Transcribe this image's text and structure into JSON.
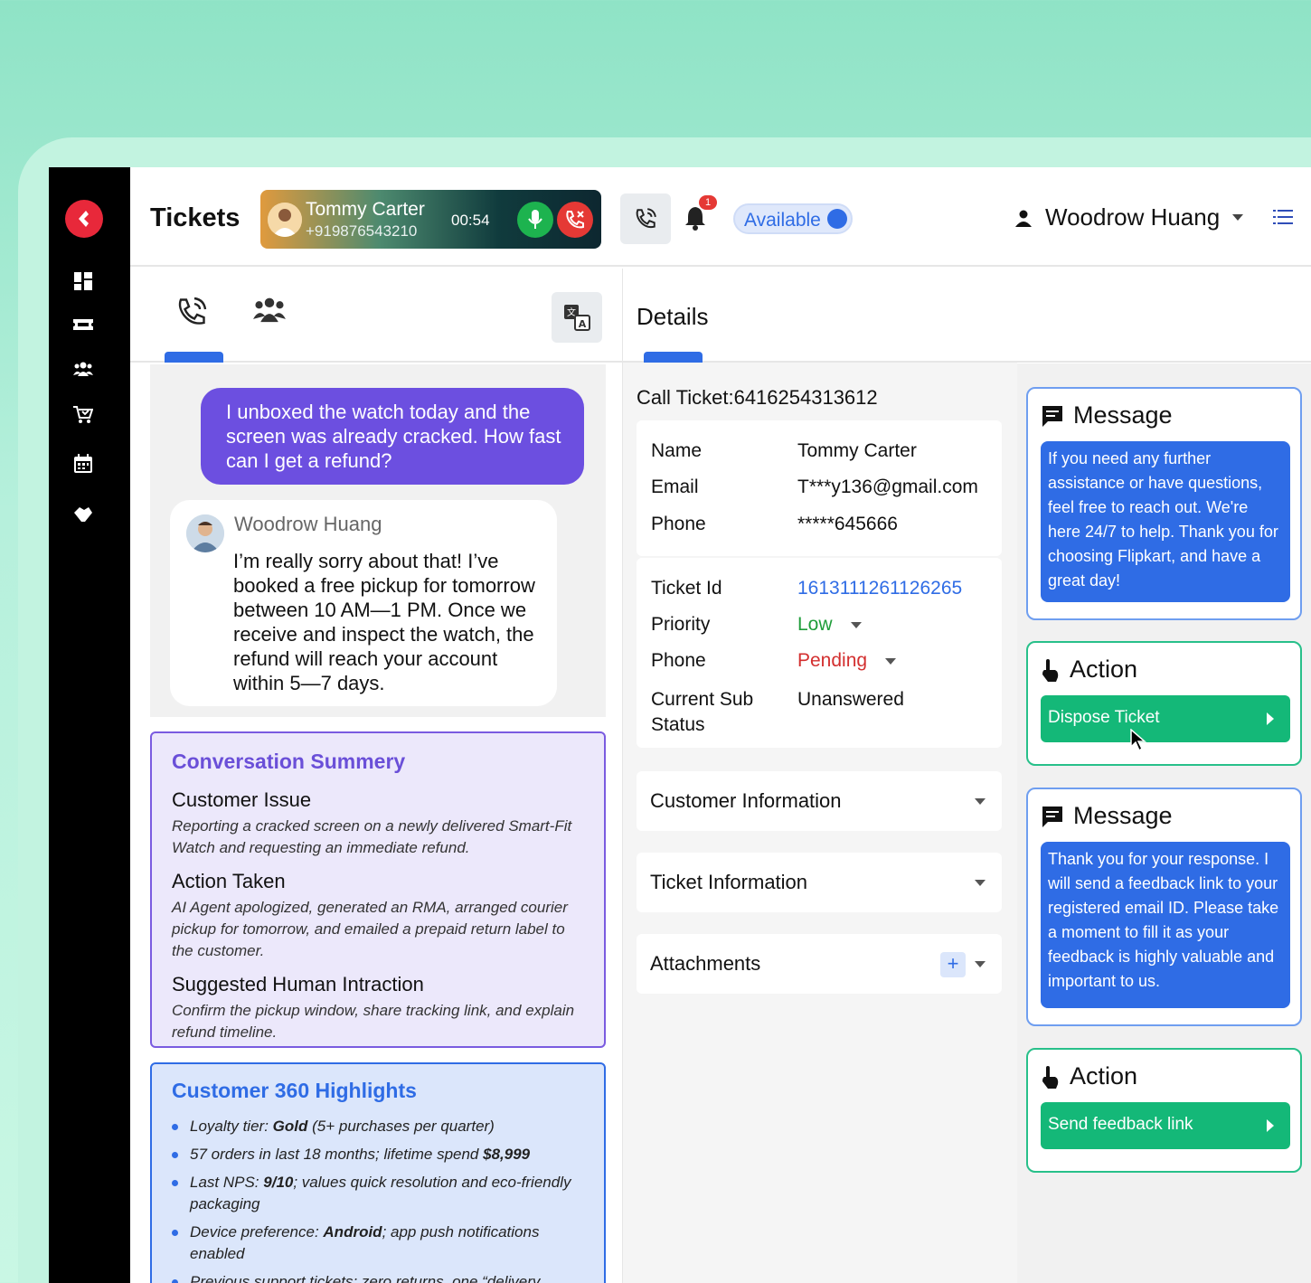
{
  "header": {
    "title": "Tickets",
    "caller": {
      "name": "Tommy Carter",
      "number": "+919876543210",
      "timer": "00:54"
    },
    "notification_count": "1",
    "status": "Available",
    "user_name": "Woodrow Huang"
  },
  "conversation": {
    "customer_message": "I unboxed the watch today and the screen was already cracked. How fast can I get a refund?",
    "agent_name": "Woodrow Huang",
    "agent_message": "I’m really sorry about that! I’ve booked a free pickup for tomorrow between 10 AM—1 PM. Once we receive and inspect the watch, the refund will reach your account within 5—7 days."
  },
  "summary": {
    "title": "Conversation Summery",
    "sections": [
      {
        "heading": "Customer Issue",
        "text": "Reporting a cracked screen on a newly delivered Smart-Fit Watch and requesting an immediate refund."
      },
      {
        "heading": "Action Taken",
        "text": "AI Agent apologized, generated an RMA, arranged courier pickup for tomorrow, and emailed a prepaid return label to the customer."
      },
      {
        "heading": "Suggested Human Intraction",
        "text": "Confirm the pickup window, share tracking link, and explain refund timeline."
      }
    ]
  },
  "highlights": {
    "title": "Customer 360 Highlights",
    "items": [
      {
        "pre": "Loyalty tier: ",
        "bold": "Gold",
        "post": " (5+ purchases per quarter)"
      },
      {
        "pre": "57 orders in last 18 months; lifetime spend ",
        "bold": "$8,999",
        "post": ""
      },
      {
        "pre": "Last NPS: ",
        "bold": "9/10",
        "post": "; values quick resolution and eco-friendly packaging"
      },
      {
        "pre": "Device preference: ",
        "bold": "Android",
        "post": "; app push notifications enabled"
      },
      {
        "pre": "Previous support tickets: zero returns, one “delivery delay” chat (resolved)",
        "bold": "",
        "post": ""
      }
    ]
  },
  "details": {
    "title": "Details",
    "call_ticket": "Call Ticket:6416254313612",
    "contact": {
      "name_label": "Name",
      "name": "Tommy Carter",
      "email_label": "Email",
      "email": "T***y136@gmail.com",
      "phone_label": "Phone",
      "phone": "*****645666"
    },
    "ticket": {
      "id_label": "Ticket Id",
      "id": "1613111261126265",
      "priority_label": "Priority",
      "priority": "Low",
      "phone_label": "Phone",
      "phone_status": "Pending",
      "substatus_label": "Current Sub Status",
      "substatus": "Unanswered"
    },
    "sections": {
      "customer_info": "Customer Information",
      "ticket_info": "Ticket Information",
      "attachments": "Attachments"
    }
  },
  "right_panel": {
    "message_label": "Message",
    "action_label": "Action",
    "message1": "If you need any further assistance or have questions, feel free to reach out. We're here 24/7 to help. Thank you for choosing Flipkart, and have a great day!",
    "action1": "Dispose Ticket",
    "message2": "Thank you for your response. I will send a feedback link to your registered email ID. Please take a moment to fill it as your feedback is highly valuable and important to us.",
    "action2": "Send feedback link"
  },
  "colors": {
    "accent": "#2f6ce5",
    "purple": "#6c4fe0",
    "green": "#14b878",
    "danger": "#e53935"
  }
}
